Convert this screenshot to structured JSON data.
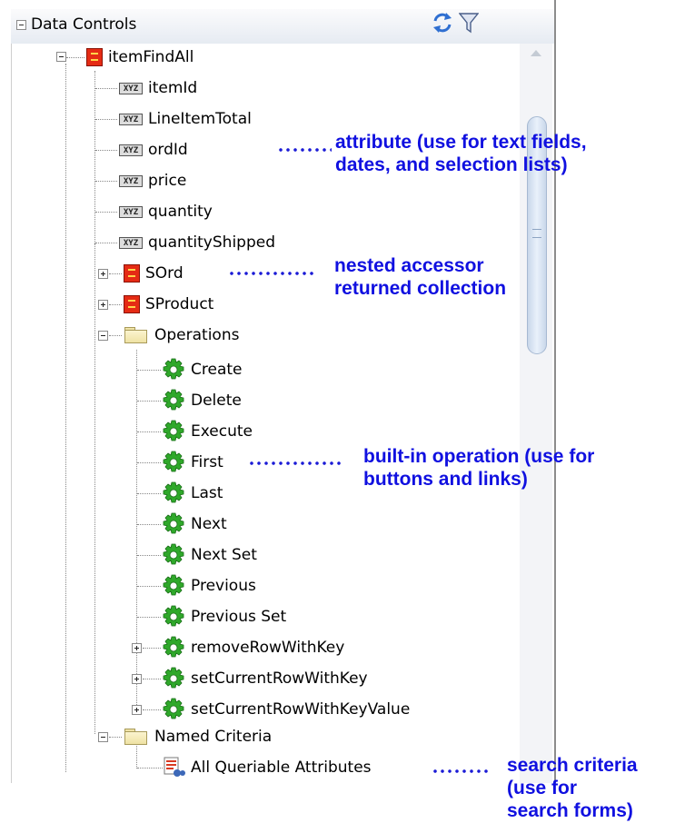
{
  "panel": {
    "title": "Data Controls"
  },
  "tree": {
    "root": "itemFindAll",
    "attributes": [
      "itemId",
      "LineItemTotal",
      "ordId",
      "price",
      "quantity",
      "quantityShipped"
    ],
    "accessors": [
      "SOrd",
      "SProduct"
    ],
    "operations_folder": "Operations",
    "operations": [
      "Create",
      "Delete",
      "Execute",
      "First",
      "Last",
      "Next",
      "Next Set",
      "Previous",
      "Previous Set"
    ],
    "method_operations": [
      "removeRowWithKey",
      "setCurrentRowWithKey",
      "setCurrentRowWithKeyValue"
    ],
    "criteria_folder": "Named Criteria",
    "criteria": [
      "All Queriable Attributes"
    ]
  },
  "annotations": {
    "attribute": [
      "attribute (use for text fields,",
      "dates, and selection lists)"
    ],
    "accessor": [
      "nested accessor",
      "returned collection"
    ],
    "operation": [
      "built-in operation (use for",
      "buttons and links)"
    ],
    "criteria": [
      "search criteria",
      "(use for",
      "search forms)"
    ]
  },
  "colors": {
    "annotation": "#1010e0",
    "collection_icon": "#e52b14",
    "gear_icon": "#2fa82a"
  },
  "icons": {
    "header": [
      "refresh-icon",
      "filter-icon"
    ],
    "collection": "collection-icon",
    "attribute": "attribute-icon",
    "folder": "folder-icon",
    "operation": "gear-icon",
    "criteria": "view-criteria-icon"
  }
}
